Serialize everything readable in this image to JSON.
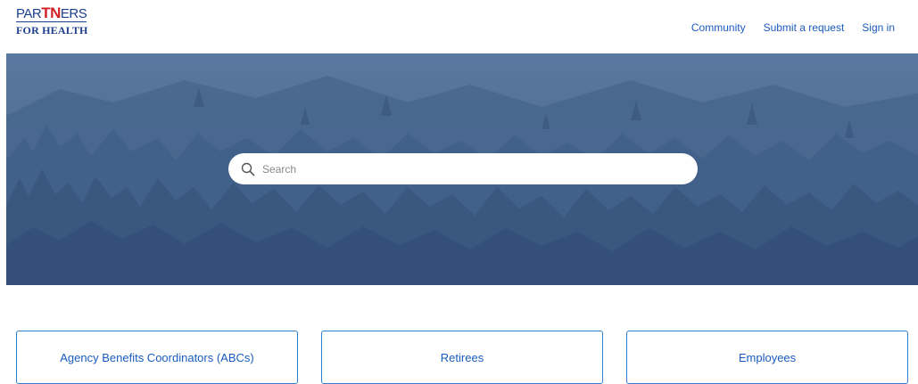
{
  "logo": {
    "line1_pre": "PAR",
    "line1_tn": "TN",
    "line1_post": "ERS",
    "line2": "FOR HEALTH"
  },
  "nav": {
    "community": "Community",
    "submit_request": "Submit a request",
    "sign_in": "Sign in"
  },
  "search": {
    "placeholder": "Search"
  },
  "categories": [
    {
      "label": "Agency Benefits Coordinators (ABCs)"
    },
    {
      "label": "Retirees"
    },
    {
      "label": "Employees"
    }
  ],
  "colors": {
    "brand_blue": "#1d3f8f",
    "brand_red": "#d21f26",
    "link": "#1a5bbf",
    "card_border": "#2f7fd1",
    "hero_tint": "#4d6a8f"
  }
}
